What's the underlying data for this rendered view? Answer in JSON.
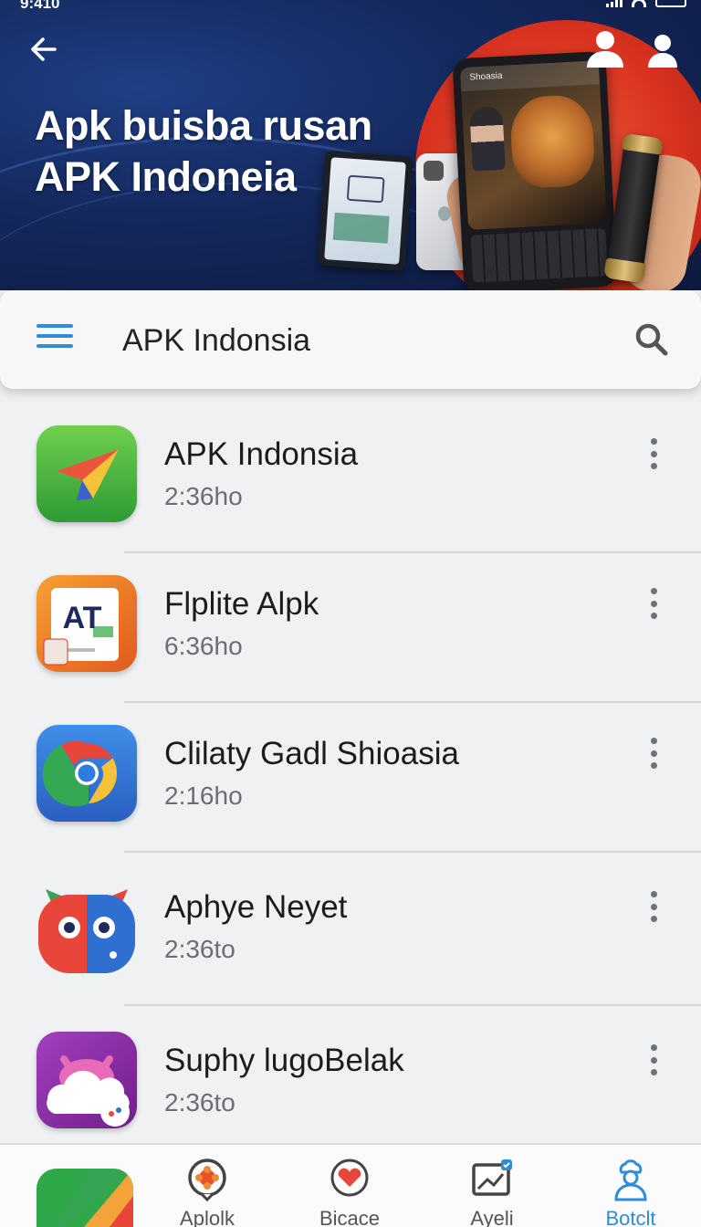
{
  "status_bar": {
    "time": "9:410"
  },
  "hero": {
    "title_line1": "Apk buisba rusan",
    "title_line2": "APK Indoneia",
    "phone_screen_label": "Shoasia"
  },
  "search": {
    "value": "APK Indonsia"
  },
  "apps": [
    {
      "name": "APK Indonsia",
      "time": "2:36ho",
      "icon": "paper-plane-icon"
    },
    {
      "name": "Flplite Alpk",
      "time": "6:36ho",
      "icon": "at-document-icon",
      "icon_text": "AT"
    },
    {
      "name": "Clilaty Gadl Shioasia",
      "time": "2:16ho",
      "icon": "chrome-icon"
    },
    {
      "name": "Aphye Neyet",
      "time": "2:36to",
      "icon": "owl-face-icon"
    },
    {
      "name": "Suphy lugoBelak",
      "time": "2:36to",
      "icon": "cloud-creature-icon"
    }
  ],
  "bottom_nav": {
    "items": [
      {
        "label": "Aplolk",
        "icon": "flower-badge-icon"
      },
      {
        "label": "Bicace",
        "icon": "heart-badge-icon"
      },
      {
        "label": "Ayeli",
        "icon": "chart-monitor-icon"
      },
      {
        "label": "Botclt",
        "icon": "chef-person-icon",
        "active": true
      }
    ]
  },
  "colors": {
    "accent": "#2f8cd8",
    "hero_bg": "#14285c",
    "hero_red": "#d8321f",
    "list_bg": "#f0f1f3"
  }
}
